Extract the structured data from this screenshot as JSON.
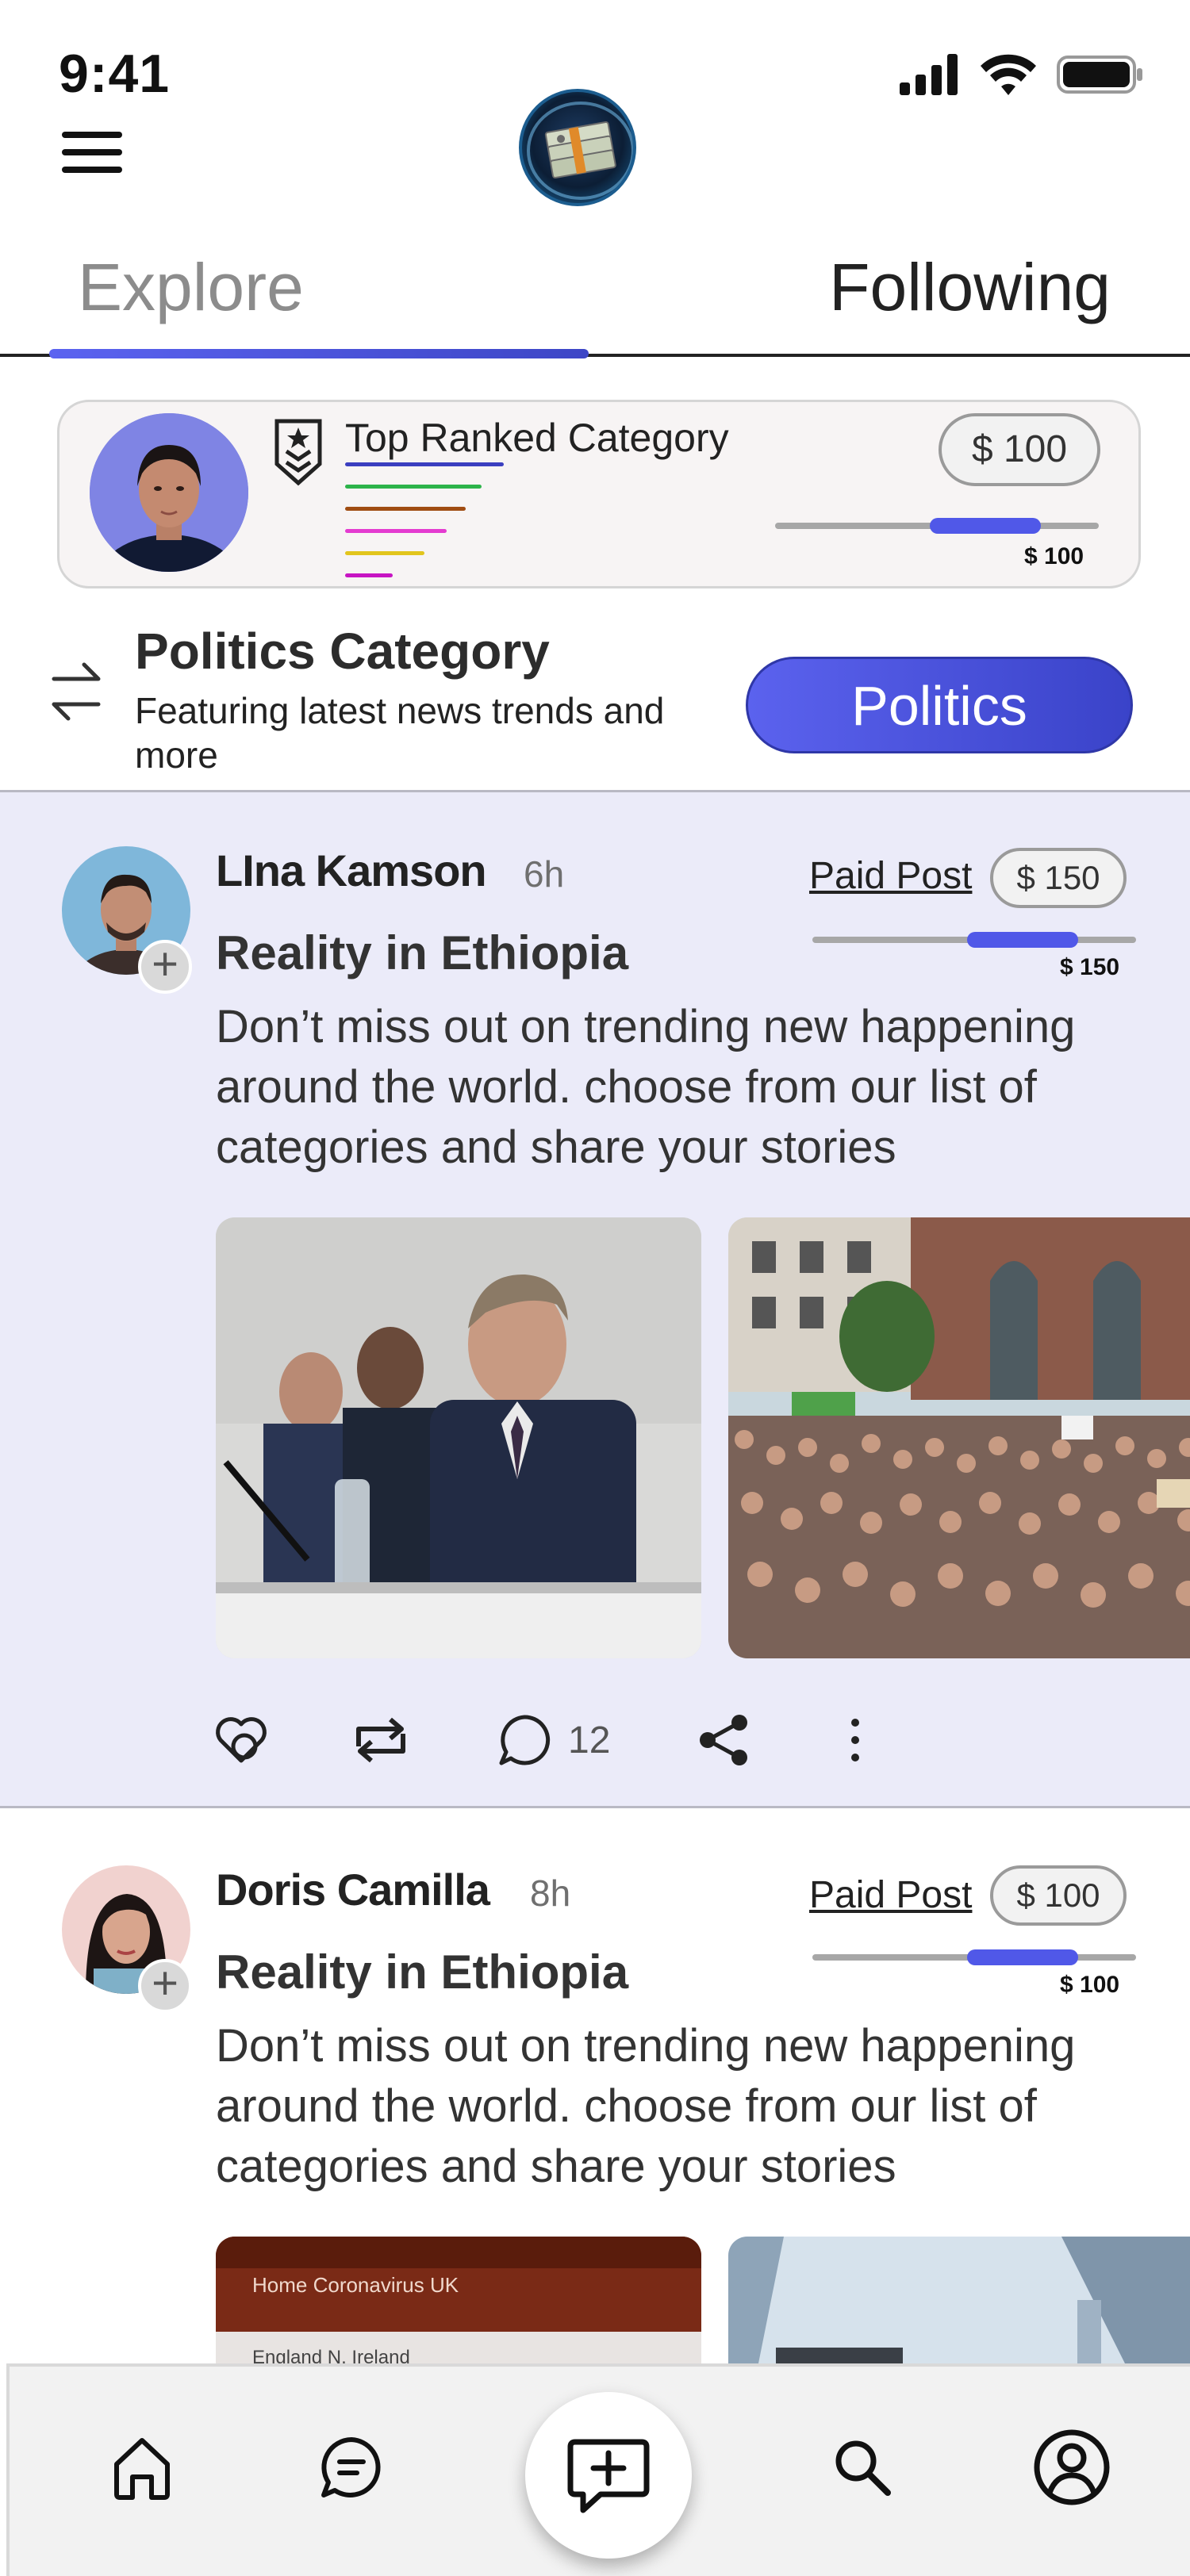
{
  "status_bar": {
    "time": "9:41"
  },
  "tabs": [
    {
      "label": "Explore",
      "active": true
    },
    {
      "label": "Following",
      "active": false
    }
  ],
  "top_ranked": {
    "title": "Top Ranked Category",
    "price": "$ 100",
    "slider_value": "$ 100",
    "slider_level_percent": 65,
    "line_colors": [
      "#3b3fc0",
      "#2db34a",
      "#a04c12",
      "#e43bd0",
      "#e2c51d",
      "#c715c3"
    ]
  },
  "category": {
    "title": "Politics Category",
    "description": "Featuring latest news trends and more",
    "button_label": "Politics"
  },
  "posts": [
    {
      "author": "LIna Kamson",
      "time": "6h",
      "paid_label": "Paid Post",
      "price": "$ 150",
      "slider_value": "$ 150",
      "slider_level_percent": 65,
      "title": "Reality in Ethiopia",
      "body": "Don’t miss out on trending new happening around the world. choose from our list of categories and  share your stories",
      "images": [
        "press-conference-photo",
        "protest-crowd-photo"
      ],
      "comment_count": "12"
    },
    {
      "author": "Doris Camilla",
      "time": "8h",
      "paid_label": "Paid Post",
      "price": "$ 100",
      "slider_value": "$ 100",
      "slider_level_percent": 65,
      "title": "Reality in Ethiopia",
      "body": "Don’t miss out on trending new happening around the world. choose from our list of categories and  share your stories",
      "images": [
        "news-website-photo",
        "skyscraper-laptop-photo"
      ]
    }
  ],
  "news_image_text": {
    "tabs": "Home   Coronavirus   UK",
    "row": "England   N. Ireland"
  },
  "nav": [
    "home-icon",
    "chat-icon",
    "create-post-icon",
    "search-icon",
    "profile-icon"
  ],
  "colors": {
    "accent": "#5058e8",
    "post_highlight": "#ebebf9"
  }
}
